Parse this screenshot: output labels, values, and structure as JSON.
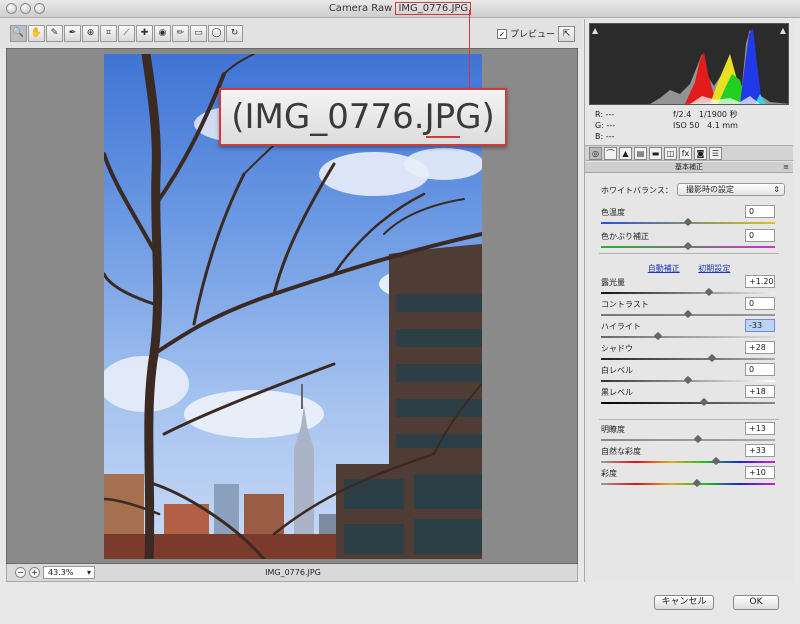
{
  "window": {
    "title_prefix": "Camera Raw",
    "title_filename": "IMG_0776.JPG"
  },
  "toolbar": {
    "tools": [
      "zoom-tool",
      "hand-tool",
      "white-balance-tool",
      "color-sampler-tool",
      "target-adjust-tool",
      "crop-tool",
      "straighten-tool",
      "spot-removal-tool",
      "redeye-tool",
      "adjustment-brush-tool",
      "graduated-filter-tool",
      "radial-filter-tool",
      "rotate-tool"
    ],
    "preview_label": "プレビュー",
    "preview_checked": true
  },
  "callout": {
    "text": "(IMG_0776.JPG)"
  },
  "status": {
    "zoom": "43.3%",
    "filename": "IMG_0776.JPG"
  },
  "readout": {
    "r": "R: ---",
    "g": "G: ---",
    "b": "B: ---",
    "aperture": "f/2.4",
    "shutter": "1/1900 秒",
    "iso": "ISO 50",
    "focal": "4.1 mm"
  },
  "panel": {
    "title": "基本補正",
    "wb_label": "ホワイトバランス：",
    "wb_value": "撮影時の設定",
    "auto_label": "自動補正",
    "default_label": "初期設定",
    "sliders": [
      {
        "label": "色温度",
        "value": "0",
        "pos": 0.5
      },
      {
        "label": "色かぶり補正",
        "value": "0",
        "pos": 0.5
      },
      {
        "label": "露光量",
        "value": "+1.20",
        "pos": 0.62
      },
      {
        "label": "コントラスト",
        "value": "0",
        "pos": 0.5
      },
      {
        "label": "ハイライト",
        "value": "-33",
        "pos": 0.33
      },
      {
        "label": "シャドウ",
        "value": "+28",
        "pos": 0.64
      },
      {
        "label": "白レベル",
        "value": "0",
        "pos": 0.5
      },
      {
        "label": "黒レベル",
        "value": "+18",
        "pos": 0.59
      },
      {
        "label": "明瞭度",
        "value": "+13",
        "pos": 0.56
      },
      {
        "label": "自然な彩度",
        "value": "+33",
        "pos": 0.66
      },
      {
        "label": "彩度",
        "value": "+10",
        "pos": 0.55
      }
    ]
  },
  "buttons": {
    "cancel": "キャンセル",
    "ok": "OK"
  }
}
